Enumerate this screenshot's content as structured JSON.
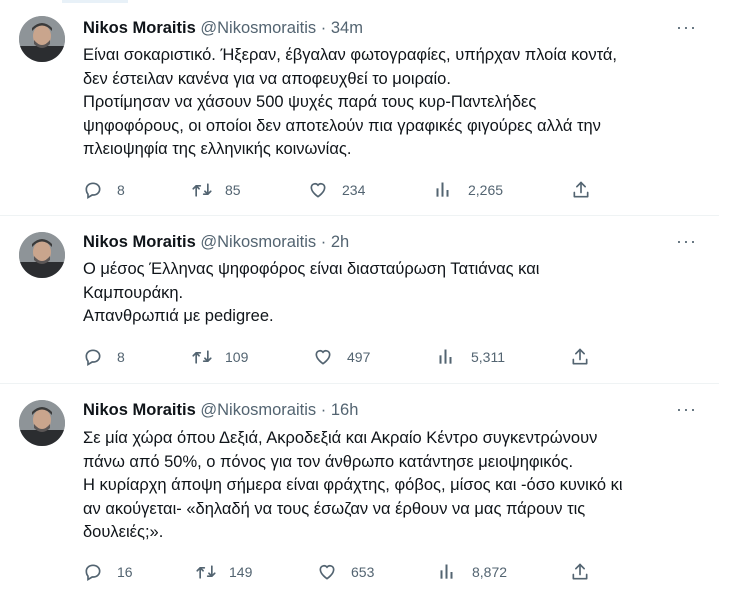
{
  "tweets": [
    {
      "name": "Nikos Moraitis",
      "handle": "@Nikosmoraitis",
      "sep": "·",
      "time": "34m",
      "more": "···",
      "lines": [
        "Είναι σοκαριστικό. Ήξεραν, έβγαλαν φωτογραφίες, υπήρχαν πλοία κοντά,",
        "δεν έστειλαν κανένα για να αποφευχθεί το μοιραίο.",
        "Προτίμησαν να χάσουν 500 ψυχές παρά τους κυρ-Παντελήδες",
        "ψηφοφόρους, οι οποίοι δεν αποτελούν πια γραφικές φιγούρες αλλά την",
        "πλειοψηφία της ελληνικής κοινωνίας."
      ],
      "replies": "8",
      "retweets": "85",
      "likes": "234",
      "views": "2,265"
    },
    {
      "name": "Nikos Moraitis",
      "handle": "@Nikosmoraitis",
      "sep": "·",
      "time": "2h",
      "more": "···",
      "lines": [
        "Ο μέσος Έλληνας ψηφοφόρος είναι διασταύρωση Τατιάνας και",
        "Καμπουράκη.",
        "Απανθρωπιά με pedigree."
      ],
      "replies": "8",
      "retweets": "109",
      "likes": "497",
      "views": "5,311"
    },
    {
      "name": "Nikos Moraitis",
      "handle": "@Nikosmoraitis",
      "sep": "·",
      "time": "16h",
      "more": "···",
      "lines": [
        "Σε μία χώρα όπου Δεξιά, Ακροδεξιά και Ακραίο Κέντρο συγκεντρώνουν",
        "πάνω από 50%, ο πόνος για τον άνθρωπο κατάντησε μειοψηφικός.",
        "Η κυρίαρχη άποψη σήμερα είναι φράχτης, φόβος, μίσος και -όσο κυνικό κι",
        "αν ακούγεται- «δηλαδή να τους έσωζαν να έρθουν να μας πάρουν τις",
        "δουλειές;»."
      ],
      "replies": "16",
      "retweets": "149",
      "likes": "653",
      "views": "8,872"
    }
  ]
}
